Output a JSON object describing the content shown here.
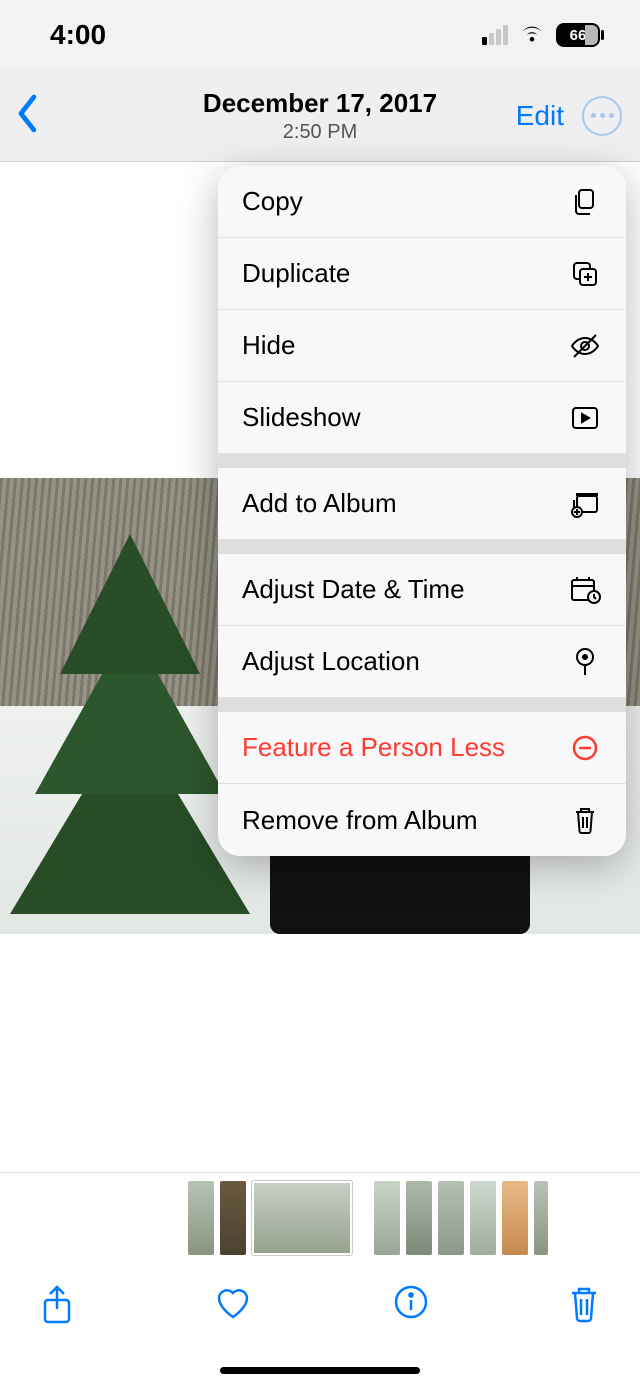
{
  "status": {
    "time": "4:00",
    "battery": "66"
  },
  "nav": {
    "date": "December 17, 2017",
    "time": "2:50 PM",
    "edit": "Edit"
  },
  "menu": {
    "copy": "Copy",
    "duplicate": "Duplicate",
    "hide": "Hide",
    "slideshow": "Slideshow",
    "add_album": "Add to Album",
    "adjust_date": "Adjust Date & Time",
    "adjust_location": "Adjust Location",
    "feature_less": "Feature a Person Less",
    "remove_album": "Remove from Album"
  }
}
